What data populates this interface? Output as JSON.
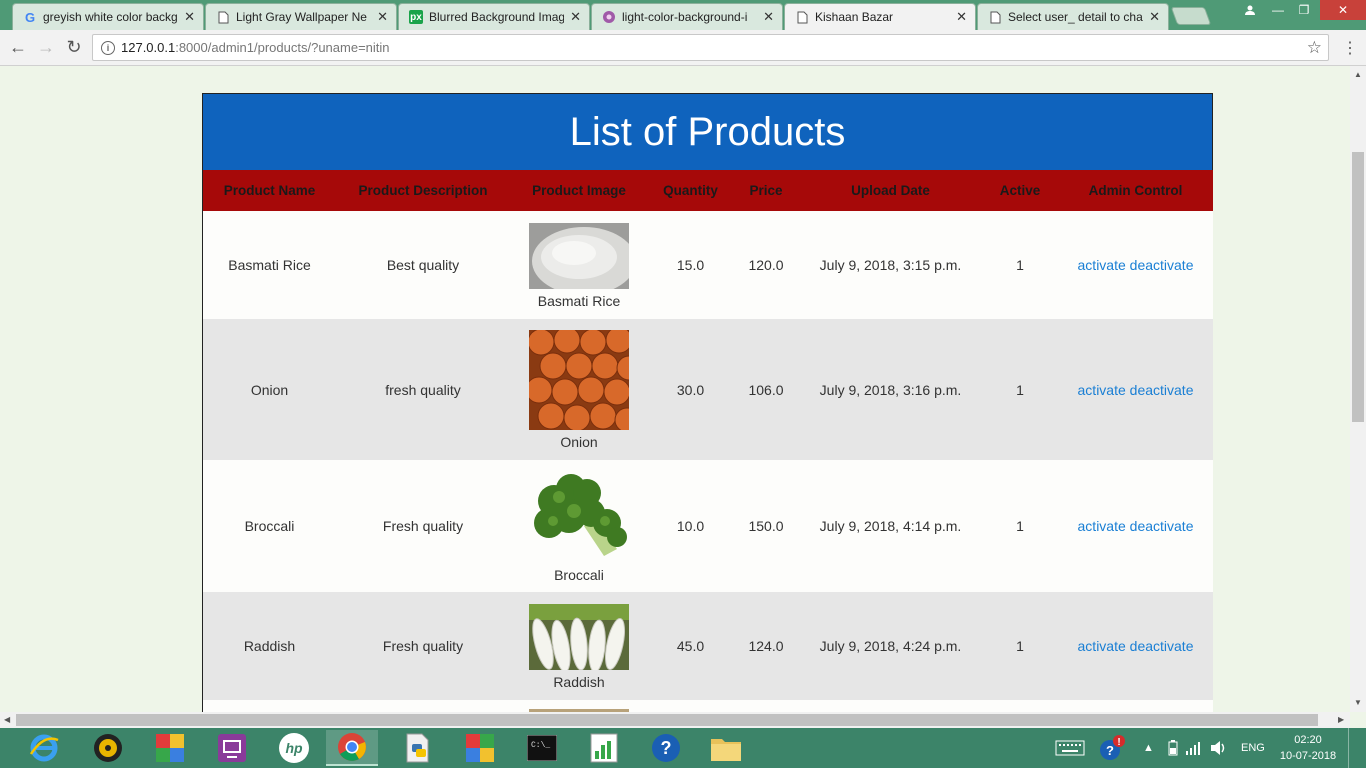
{
  "browser": {
    "tabs": [
      {
        "label": "greyish white color backg",
        "icon": "google-icon"
      },
      {
        "label": "Light Gray Wallpaper Ne",
        "icon": "page-icon"
      },
      {
        "label": "Blurred Background Imag",
        "icon": "px-icon"
      },
      {
        "label": "light-color-background-i",
        "icon": "flower-icon"
      },
      {
        "label": "Kishaan Bazar",
        "icon": "page-icon"
      },
      {
        "label": "Select user_ detail to char",
        "icon": "page-icon"
      }
    ],
    "url_host": "127.0.0.1",
    "url_path": ":8000/admin1/products/?uname=nitin"
  },
  "page": {
    "title": "List of Products",
    "columns": [
      "Product Name",
      "Product Description",
      "Product Image",
      "Quantity",
      "Price",
      "Upload Date",
      "Active",
      "Admin Control"
    ],
    "products": [
      {
        "name": "Basmati Rice",
        "description": "Best quality",
        "image_caption": "Basmati Rice",
        "quantity": "15.0",
        "price": "120.0",
        "upload_date": "July 9, 2018, 3:15 p.m.",
        "active": "1",
        "activate": "activate",
        "deactivate": "deactivate"
      },
      {
        "name": "Onion",
        "description": "fresh quality",
        "image_caption": "Onion",
        "quantity": "30.0",
        "price": "106.0",
        "upload_date": "July 9, 2018, 3:16 p.m.",
        "active": "1",
        "activate": "activate",
        "deactivate": "deactivate"
      },
      {
        "name": "Broccali",
        "description": "Fresh quality",
        "image_caption": "Broccali",
        "quantity": "10.0",
        "price": "150.0",
        "upload_date": "July 9, 2018, 4:14 p.m.",
        "active": "1",
        "activate": "activate",
        "deactivate": "deactivate"
      },
      {
        "name": "Raddish",
        "description": "Fresh quality",
        "image_caption": "Raddish",
        "quantity": "45.0",
        "price": "124.0",
        "upload_date": "July 9, 2018, 4:24 p.m.",
        "active": "1",
        "activate": "activate",
        "deactivate": "deactivate"
      }
    ]
  },
  "taskbar": {
    "language": "ENG",
    "time": "02:20",
    "date": "10-07-2018"
  },
  "colors": {
    "header_blue": "#0f63bd",
    "table_header_red": "#a60909",
    "link_blue": "#1a7fd4",
    "taskbar_green": "#3c8469"
  }
}
